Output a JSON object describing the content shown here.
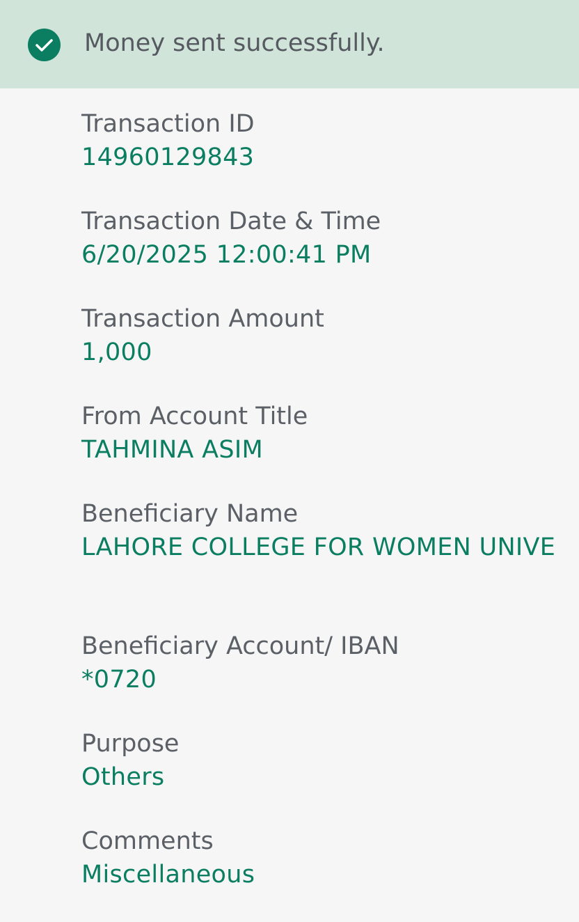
{
  "banner": {
    "icon": "check-circle-icon",
    "message": "Money sent successfully."
  },
  "colors": {
    "banner_background": "#d0e4d9",
    "accent": "#0b7e61",
    "label_text": "#5b5f66",
    "page_background": "#f6f6f6"
  },
  "details": [
    {
      "label": "Transaction ID",
      "value": "14960129843"
    },
    {
      "label": "Transaction Date & Time",
      "value": "6/20/2025 12:00:41 PM"
    },
    {
      "label": "Transaction Amount",
      "value": "1,000"
    },
    {
      "label": "From Account Title",
      "value": "TAHMINA ASIM"
    },
    {
      "label": "Beneficiary Name",
      "value": "LAHORE COLLEGE FOR WOMEN UNIVE"
    },
    {
      "label": "Beneficiary Account/ IBAN",
      "value": "*0720"
    },
    {
      "label": "Purpose",
      "value": "Others"
    },
    {
      "label": "Comments",
      "value": "Miscellaneous"
    }
  ]
}
